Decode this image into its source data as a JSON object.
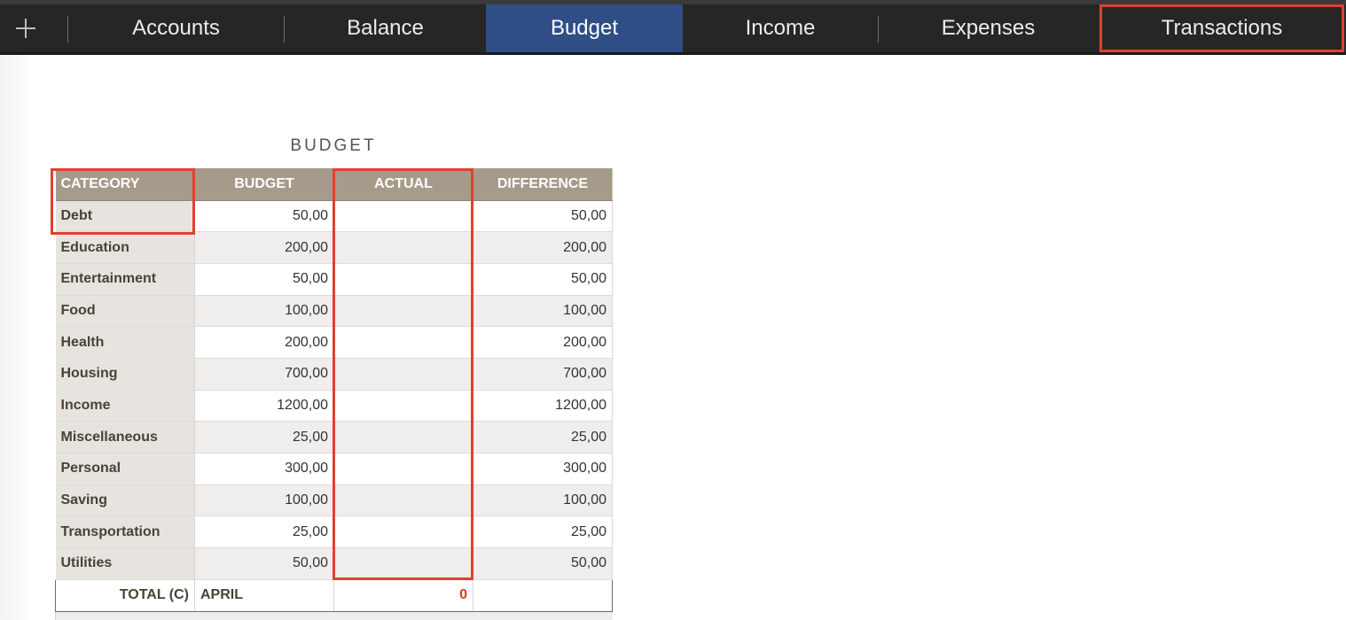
{
  "tabs": [
    {
      "label": "Accounts",
      "active": false
    },
    {
      "label": "Balance",
      "active": false
    },
    {
      "label": "Budget",
      "active": true
    },
    {
      "label": "Income",
      "active": false
    },
    {
      "label": "Expenses",
      "active": false
    },
    {
      "label": "Transactions",
      "active": false
    }
  ],
  "sheet": {
    "title": "BUDGET",
    "columns": [
      "CATEGORY",
      "BUDGET",
      "ACTUAL",
      "DIFFERENCE"
    ],
    "rows": [
      {
        "category": "Debt",
        "budget": "50,00",
        "actual": "",
        "difference": "50,00"
      },
      {
        "category": "Education",
        "budget": "200,00",
        "actual": "",
        "difference": "200,00"
      },
      {
        "category": "Entertainment",
        "budget": "50,00",
        "actual": "",
        "difference": "50,00"
      },
      {
        "category": "Food",
        "budget": "100,00",
        "actual": "",
        "difference": "100,00"
      },
      {
        "category": "Health",
        "budget": "200,00",
        "actual": "",
        "difference": "200,00"
      },
      {
        "category": "Housing",
        "budget": "700,00",
        "actual": "",
        "difference": "700,00"
      },
      {
        "category": "Income",
        "budget": "1200,00",
        "actual": "",
        "difference": "1200,00"
      },
      {
        "category": "Miscellaneous",
        "budget": "25,00",
        "actual": "",
        "difference": "25,00"
      },
      {
        "category": "Personal",
        "budget": "300,00",
        "actual": "",
        "difference": "300,00"
      },
      {
        "category": "Saving",
        "budget": "100,00",
        "actual": "",
        "difference": "100,00"
      },
      {
        "category": "Transportation",
        "budget": "25,00",
        "actual": "",
        "difference": "25,00"
      },
      {
        "category": "Utilities",
        "budget": "50,00",
        "actual": "",
        "difference": "50,00"
      }
    ],
    "total": {
      "label": "TOTAL (C)",
      "month": "APRIL",
      "actual": "0",
      "difference": ""
    }
  },
  "colors": {
    "active_tab": "#2f4e86",
    "highlight": "#e0412e",
    "header_bg": "#a69a8a",
    "category_bg": "#e7e4df",
    "total_value": "#d9381e"
  },
  "icons": {
    "add": "plus-icon"
  }
}
